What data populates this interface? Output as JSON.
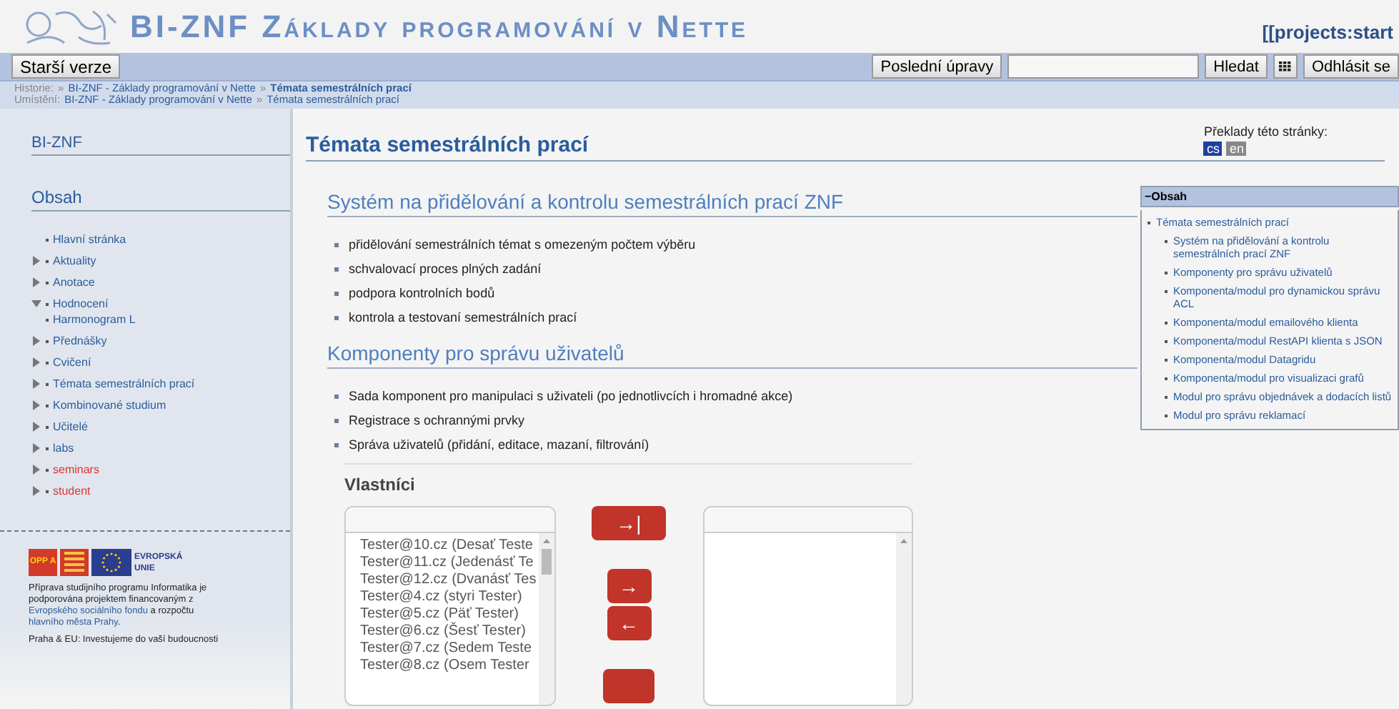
{
  "header": {
    "title": "BI-ZNF Základy programování v Nette",
    "page_id": "[[projects:start"
  },
  "toolbar": {
    "left_buttons": [
      "Starší verze"
    ],
    "recent_button": "Poslední úpravy",
    "search_button": "Hledat",
    "logout_button": "Odhlásit se"
  },
  "breadcrumbs": [
    {
      "label": "Historie:",
      "items": [
        {
          "sep": "»",
          "text": "BI-ZNF - Základy programování v Nette",
          "current": false
        },
        {
          "sep": "»",
          "text": "Témata semestrálních prací",
          "current": true
        }
      ]
    },
    {
      "label": "Umístění:",
      "items": [
        {
          "text": "BI-ZNF - Základy programování v Nette",
          "current": false
        },
        {
          "sep": "»",
          "text": "Témata semestrálních prací",
          "current": false
        }
      ]
    }
  ],
  "sidebar": {
    "title": "BI-ZNF",
    "toc_title": "Obsah",
    "items": [
      {
        "kind": "leaf",
        "label": "Hlavní stránka",
        "missing": false
      },
      {
        "kind": "node",
        "label": "Aktuality",
        "expanded": false,
        "missing": false
      },
      {
        "kind": "node",
        "label": "Anotace",
        "expanded": false,
        "missing": false
      },
      {
        "kind": "node",
        "label": "Hodnocení",
        "expanded": true,
        "missing": false,
        "children": [
          {
            "kind": "leaf",
            "label": "Harmonogram L",
            "missing": false
          }
        ]
      },
      {
        "kind": "node",
        "label": "Přednášky",
        "expanded": false,
        "missing": false
      },
      {
        "kind": "node",
        "label": "Cvičení",
        "expanded": false,
        "missing": false
      },
      {
        "kind": "node",
        "label": "Témata semestrálních prací",
        "expanded": false,
        "missing": false
      },
      {
        "kind": "node",
        "label": "Kombinované studium",
        "expanded": false,
        "missing": false
      },
      {
        "kind": "node",
        "label": "Učitelé",
        "expanded": false,
        "missing": false
      },
      {
        "kind": "node",
        "label": "labs",
        "expanded": false,
        "missing": false
      },
      {
        "kind": "node",
        "label": "seminars",
        "expanded": false,
        "missing": true
      },
      {
        "kind": "node",
        "label": "student",
        "expanded": false,
        "missing": true
      }
    ],
    "logos": {
      "opp": "OPP A",
      "eu": "EVROPSKÁ UNIE"
    },
    "note": [
      {
        "text": "Příprava studijního programu Informatika je podporována projektem financovaným z ",
        "link": false
      },
      {
        "text": "Evropského sociálního fondu",
        "link": true
      },
      {
        "text": " a rozpočtu ",
        "link": false
      },
      {
        "text": "hlavního města Prahy",
        "link": true
      },
      {
        "text": ".",
        "link": false
      }
    ],
    "motto": "Praha & EU: Investujeme do vaší budoucnosti"
  },
  "page": {
    "title": "Témata semestrálních prací",
    "translations": {
      "label": "Překlady této stránky:",
      "langs": [
        {
          "code": "cs",
          "selected": true
        },
        {
          "code": "en",
          "selected": false
        }
      ]
    },
    "sections": [
      {
        "heading": "Systém na přidělování a kontrolu semestrálních prací ZNF",
        "bullets": [
          "přidělování semestrálních témat s omezeným počtem výběru",
          "schvalovací proces plných zadání",
          "podpora kontrolních bodů",
          "kontrola a testovaní semestrálních prací"
        ]
      },
      {
        "heading": "Komponenty pro správu uživatelů",
        "bullets": [
          "Sada komponent pro manipulaci s uživateli (po jednotlivcích i hromadné akce)",
          "Registrace s ochrannými prvky",
          "Správa uživatelů (přidání, editace, mazaní, filtrování)"
        ]
      }
    ],
    "toc": {
      "title": "−Obsah",
      "items": [
        {
          "label": "Témata semestrálních prací",
          "children": [
            {
              "label": "Systém na přidělování a kontrolu semestrálních prací ZNF"
            },
            {
              "label": "Komponenty pro správu uživatelů"
            },
            {
              "label": "Komponenta/modul pro dynamickou správu ACL"
            },
            {
              "label": "Komponenta/modul emailového klienta"
            },
            {
              "label": "Komponenta/modul RestAPI klienta s JSON"
            },
            {
              "label": "Komponenta/modul Datagridu"
            },
            {
              "label": "Komponenta/modul pro visualizaci grafů"
            },
            {
              "label": "Modul pro správu objednávek a dodacích listů"
            },
            {
              "label": "Modul pro správu reklamací"
            }
          ]
        }
      ]
    },
    "picker": {
      "title": "Vlastníci",
      "left_items": [
        "Tester@10.cz (Desať Teste",
        "Tester@11.cz (Jedenásť Te",
        "Tester@12.cz (Dvanásť Tes",
        "Tester@4.cz (styri Tester)",
        "Tester@5.cz (Päť Tester)",
        "Tester@6.cz (Šesť Tester)",
        "Tester@7.cz (Sedem Teste",
        "Tester@8.cz (Osem Tester"
      ],
      "buttons": [
        {
          "kind": "all-right",
          "label": "→|"
        },
        {
          "kind": "right",
          "label": "→"
        },
        {
          "kind": "left",
          "label": "←"
        },
        {
          "kind": "all-left"
        }
      ]
    }
  }
}
